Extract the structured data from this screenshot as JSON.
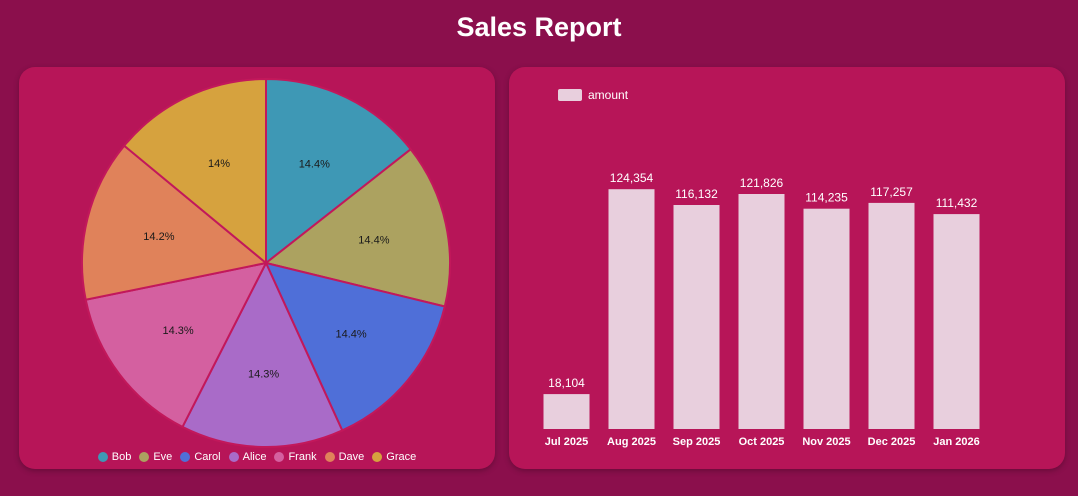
{
  "header": {
    "title": "Sales Report"
  },
  "chart_data": [
    {
      "type": "pie",
      "slices": [
        {
          "name": "Bob",
          "value": 14.4,
          "label": "14.4%",
          "color": "#3e98b5"
        },
        {
          "name": "Eve",
          "value": 14.4,
          "label": "14.4%",
          "color": "#aca260"
        },
        {
          "name": "Carol",
          "value": 14.4,
          "label": "14.4%",
          "color": "#4f6fd8"
        },
        {
          "name": "Alice",
          "value": 14.3,
          "label": "14.3%",
          "color": "#a96bc8"
        },
        {
          "name": "Frank",
          "value": 14.3,
          "label": "14.3%",
          "color": "#d460a0"
        },
        {
          "name": "Dave",
          "value": 14.2,
          "label": "14.2%",
          "color": "#e0825a"
        },
        {
          "name": "Grace",
          "value": 14.0,
          "label": "14%",
          "color": "#d6a23e"
        }
      ],
      "legend_position": "bottom"
    },
    {
      "type": "bar",
      "series": [
        {
          "name": "amount",
          "color": "#e8cfdd",
          "values": [
            18104,
            124354,
            116132,
            121826,
            114235,
            117257,
            111432
          ],
          "labels": [
            "18,104",
            "124,354",
            "116,132",
            "121,826",
            "114,235",
            "117,257",
            "111,432"
          ]
        }
      ],
      "categories": [
        "Jul 2025",
        "Aug 2025",
        "Sep 2025",
        "Oct 2025",
        "Nov 2025",
        "Dec 2025",
        "Jan 2026"
      ],
      "ylim": [
        0,
        140000
      ],
      "grid": false,
      "legend_position": "top-left"
    }
  ]
}
